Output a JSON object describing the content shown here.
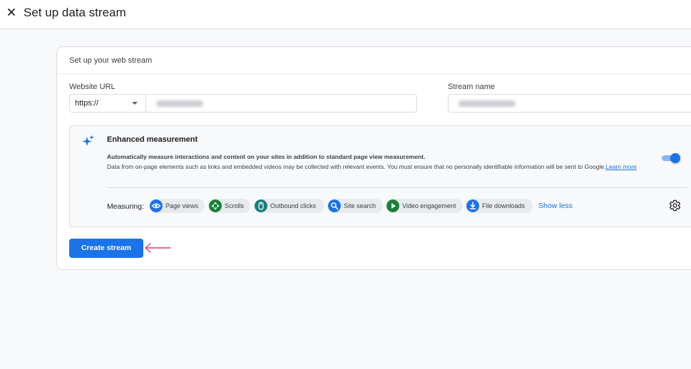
{
  "header": {
    "title": "Set up data stream",
    "close_icon": "close-icon"
  },
  "card": {
    "title": "Set up your web stream",
    "website_url": {
      "label": "Website URL",
      "protocol": "https://",
      "value_blurred": true
    },
    "stream_name": {
      "label": "Stream name",
      "value_blurred": true
    },
    "enhanced_measurement": {
      "title": "Enhanced measurement",
      "description": "Automatically measure interactions and content on your sites in addition to standard page view measurement.",
      "notice": "Data from on-page elements such as links and embedded videos may be collected with relevant events. You must ensure that no personally identifiable information will be sent to Google.",
      "learn_more": "Learn more",
      "enabled": true,
      "measuring_label": "Measuring:",
      "chips": [
        {
          "label": "Page views",
          "icon": "eye-icon",
          "color": "#1a73e8"
        },
        {
          "label": "Scrolls",
          "icon": "scroll-arrows-icon",
          "color": "#188038"
        },
        {
          "label": "Outbound clicks",
          "icon": "mouse-icon",
          "color": "#12807a"
        },
        {
          "label": "Site search",
          "icon": "search-icon",
          "color": "#1a73e8"
        },
        {
          "label": "Video engagement",
          "icon": "play-icon",
          "color": "#188038"
        },
        {
          "label": "File downloads",
          "icon": "download-icon",
          "color": "#1a73e8"
        }
      ],
      "show_less": "Show less"
    },
    "create_button": "Create stream"
  },
  "colors": {
    "accent": "#1a73e8",
    "annotation_arrow": "#d93f6e"
  }
}
